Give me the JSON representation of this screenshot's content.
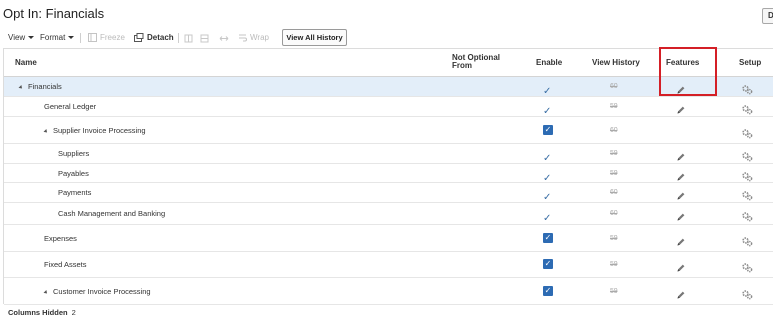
{
  "page": {
    "title": "Opt In: Financials",
    "corner_button": "D"
  },
  "toolbar": {
    "view": "View",
    "format": "Format",
    "freeze": "Freeze",
    "detach": "Detach",
    "wrap": "Wrap",
    "view_all_history": "View All History"
  },
  "table": {
    "headers": {
      "name": "Name",
      "not_optional_from": "Not Optional From",
      "enable": "Enable",
      "view_history": "View History",
      "features": "Features",
      "setup": "Setup"
    },
    "rows": [
      {
        "name": "Financials",
        "level": 0,
        "expandable": true,
        "selected": true,
        "enable": "check",
        "history": "60",
        "features": true
      },
      {
        "name": "General Ledger",
        "level": 1,
        "expandable": false,
        "selected": false,
        "enable": "check",
        "history": "59",
        "features": true
      },
      {
        "name": "Supplier Invoice Processing",
        "level": 1,
        "expandable": true,
        "selected": false,
        "enable": "checkbox",
        "history": "60",
        "features": false
      },
      {
        "name": "Suppliers",
        "level": 2,
        "expandable": false,
        "selected": false,
        "enable": "check",
        "history": "59",
        "features": true
      },
      {
        "name": "Payables",
        "level": 2,
        "expandable": false,
        "selected": false,
        "enable": "check",
        "history": "59",
        "features": true
      },
      {
        "name": "Payments",
        "level": 2,
        "expandable": false,
        "selected": false,
        "enable": "check",
        "history": "60",
        "features": true
      },
      {
        "name": "Cash Management and Banking",
        "level": 2,
        "expandable": false,
        "selected": false,
        "enable": "check",
        "history": "60",
        "features": true
      },
      {
        "name": "Expenses",
        "level": 1,
        "expandable": false,
        "selected": false,
        "enable": "checkbox",
        "history": "59",
        "features": true
      },
      {
        "name": "Fixed Assets",
        "level": 1,
        "expandable": false,
        "selected": false,
        "enable": "checkbox",
        "history": "59",
        "features": true
      },
      {
        "name": "Customer Invoice Processing",
        "level": 1,
        "expandable": true,
        "selected": false,
        "enable": "checkbox",
        "history": "59",
        "features": true
      }
    ]
  },
  "footer": {
    "label": "Columns Hidden",
    "count": "2"
  },
  "colors": {
    "selected_row": "#e3eef9",
    "checkbox_blue": "#2d6bb3",
    "highlight_red": "#d41f26"
  },
  "icons": {
    "edit": "pencil-icon",
    "setup": "gears-icon",
    "freeze": "freeze-icon",
    "detach": "detach-icon",
    "wrap": "wrap-icon"
  }
}
